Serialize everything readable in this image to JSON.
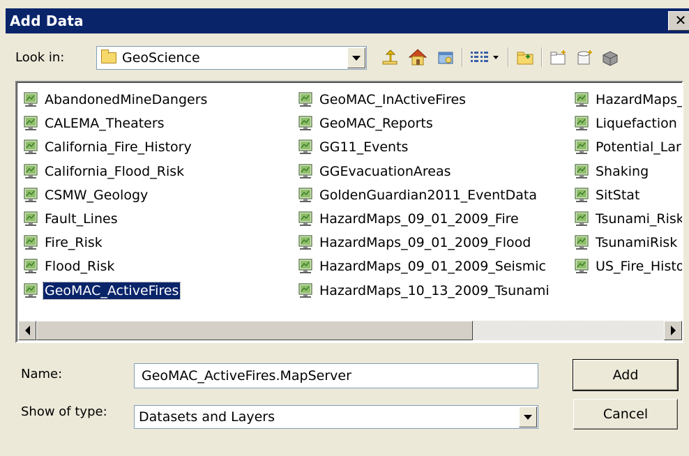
{
  "window": {
    "title": "Add Data",
    "close_glyph": "✕"
  },
  "look_in": {
    "label": "Look in:",
    "value": "GeoScience"
  },
  "toolbar": {
    "icons": [
      "up-one-level-icon",
      "home-icon",
      "catalog-icon",
      "view-menu-icon",
      "connect-folder-icon",
      "new-folder-icon",
      "new-geodatabase-icon",
      "new-shapefile-icon"
    ]
  },
  "files": {
    "column1": [
      "AbandonedMineDangers",
      "CALEMA_Theaters",
      "California_Fire_History",
      "California_Flood_Risk",
      "CSMW_Geology",
      "Fault_Lines",
      "Fire_Risk",
      "Flood_Risk",
      "GeoMAC_ActiveFires"
    ],
    "column2": [
      "GeoMAC_InActiveFires",
      "GeoMAC_Reports",
      "GG11_Events",
      "GGEvacuationAreas",
      "GoldenGuardian2011_EventData",
      "HazardMaps_09_01_2009_Fire",
      "HazardMaps_09_01_2009_Flood",
      "HazardMaps_09_01_2009_Seismic",
      "HazardMaps_10_13_2009_Tsunami"
    ],
    "column3": [
      "HazardMaps_",
      "Liquefaction",
      "Potential_Lar",
      "Shaking",
      "SitStat",
      "Tsunami_Risk",
      "TsunamiRisk",
      "US_Fire_Histo"
    ],
    "selected": "GeoMAC_ActiveFires"
  },
  "name_field": {
    "label": "Name:",
    "value": "GeoMAC_ActiveFires.MapServer"
  },
  "type_field": {
    "label": "Show of type:",
    "value": "Datasets and Layers"
  },
  "buttons": {
    "add": "Add",
    "cancel": "Cancel"
  },
  "colors": {
    "titlebar": "#0a246a",
    "selection": "#0a246a",
    "face": "#ece9d8"
  }
}
